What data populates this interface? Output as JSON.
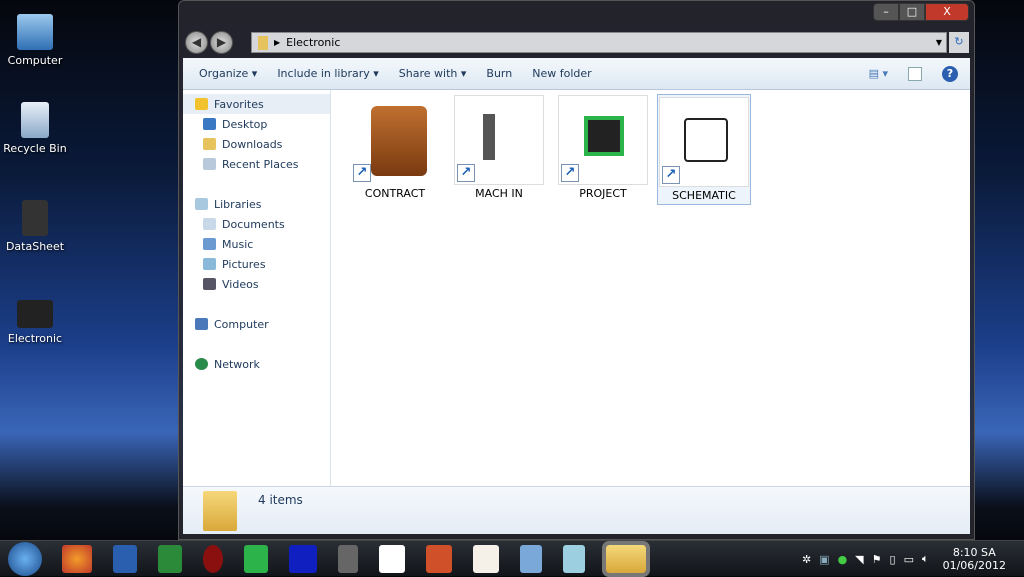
{
  "desktop": {
    "icons": [
      {
        "label": "Computer"
      },
      {
        "label": "Recycle Bin"
      },
      {
        "label": "DataSheet"
      },
      {
        "label": "Electronic"
      }
    ]
  },
  "window": {
    "controls": {
      "minimize": "–",
      "maximize": "□",
      "close": "X"
    },
    "address": {
      "path": "Electronic"
    },
    "toolbar": {
      "organize": "Organize",
      "include": "Include in library",
      "share": "Share with",
      "burn": "Burn",
      "new_folder": "New folder"
    },
    "nav": {
      "favorites": "Favorites",
      "fav_items": [
        "Desktop",
        "Downloads",
        "Recent Places"
      ],
      "libraries": "Libraries",
      "lib_items": [
        "Documents",
        "Music",
        "Pictures",
        "Videos"
      ],
      "computer": "Computer",
      "network": "Network"
    },
    "items": [
      {
        "label": "CONTRACT"
      },
      {
        "label": "MACH IN"
      },
      {
        "label": "PROJECT"
      },
      {
        "label": "SCHEMATIC"
      }
    ],
    "details": {
      "count": "4 items"
    }
  },
  "taskbar": {
    "apps": [
      "start",
      "firefox",
      "word",
      "excel",
      "bug",
      "c-app",
      "isis",
      "mach",
      "schematic",
      "powerpoint",
      "cat",
      "calculator",
      "notepad",
      "explorer"
    ],
    "time": "8:10 SA",
    "date": "01/06/2012"
  }
}
